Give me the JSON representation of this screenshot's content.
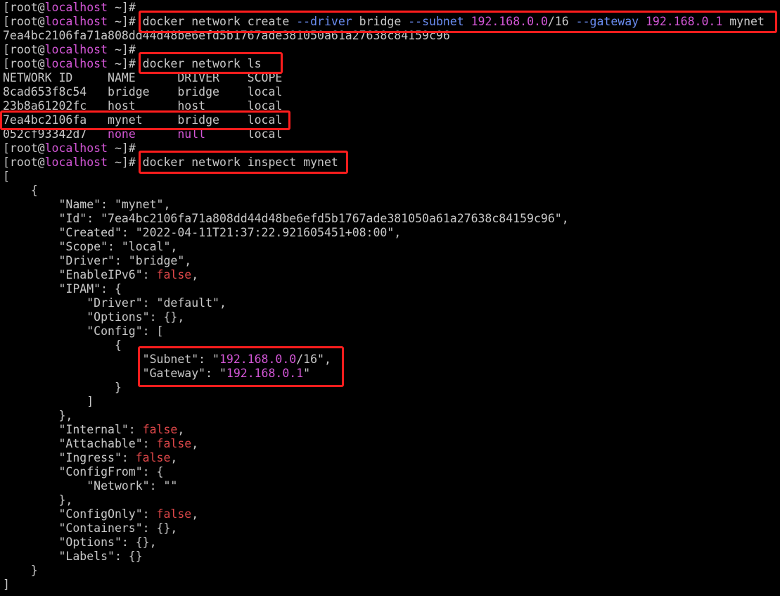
{
  "colors": {
    "background": "#000000",
    "text": "#c8c8c8",
    "host": "#d356d6",
    "flag": "#6a8cf0",
    "ip": "#d356d6",
    "boolean_false": "#e0484a",
    "highlight": "#ff1d1d"
  },
  "terminal": {
    "lines": [
      [
        {
          "t": "[root@",
          "c": "default"
        },
        {
          "t": "localhost",
          "c": "host"
        },
        {
          "t": " ~]#",
          "c": "default"
        }
      ],
      [
        {
          "t": "[root@",
          "c": "default"
        },
        {
          "t": "localhost",
          "c": "host"
        },
        {
          "t": " ~]# docker network create ",
          "c": "default"
        },
        {
          "t": "--driver",
          "c": "flag"
        },
        {
          "t": " bridge ",
          "c": "default"
        },
        {
          "t": "--subnet",
          "c": "flag"
        },
        {
          "t": " ",
          "c": "default"
        },
        {
          "t": "192.168.0.0",
          "c": "ip"
        },
        {
          "t": "/16 ",
          "c": "default"
        },
        {
          "t": "--gateway",
          "c": "flag"
        },
        {
          "t": " ",
          "c": "default"
        },
        {
          "t": "192.168.0.1",
          "c": "ip"
        },
        {
          "t": " mynet",
          "c": "default"
        }
      ],
      [
        {
          "t": "7ea4bc2106fa71a808dd44d48be6efd5b1767ade381050a61a27638c84159c96",
          "c": "default"
        }
      ],
      [
        {
          "t": "[root@",
          "c": "default"
        },
        {
          "t": "localhost",
          "c": "host"
        },
        {
          "t": " ~]#",
          "c": "default"
        }
      ],
      [
        {
          "t": "[root@",
          "c": "default"
        },
        {
          "t": "localhost",
          "c": "host"
        },
        {
          "t": " ~]# docker network ls",
          "c": "default"
        }
      ],
      [
        {
          "t": "NETWORK ID     NAME      DRIVER    SCOPE",
          "c": "default"
        }
      ],
      [
        {
          "t": "8cad653f8c54   bridge    bridge    local",
          "c": "default"
        }
      ],
      [
        {
          "t": "23b8a61202fc   host      host      local",
          "c": "default"
        }
      ],
      [
        {
          "t": "7ea4bc2106fa   mynet     bridge    local",
          "c": "default"
        }
      ],
      [
        {
          "t": "052cf93342d7   ",
          "c": "default"
        },
        {
          "t": "none",
          "c": "magenta"
        },
        {
          "t": "      ",
          "c": "default"
        },
        {
          "t": "null",
          "c": "magenta"
        },
        {
          "t": "      local",
          "c": "default"
        }
      ],
      [
        {
          "t": "[root@",
          "c": "default"
        },
        {
          "t": "localhost",
          "c": "host"
        },
        {
          "t": " ~]#",
          "c": "default"
        }
      ],
      [
        {
          "t": "[root@",
          "c": "default"
        },
        {
          "t": "localhost",
          "c": "host"
        },
        {
          "t": " ~]# docker network inspect mynet",
          "c": "default"
        }
      ],
      [
        {
          "t": "[",
          "c": "default"
        }
      ],
      [
        {
          "t": "    {",
          "c": "default"
        }
      ],
      [
        {
          "t": "        \"Name\": \"mynet\",",
          "c": "default"
        }
      ],
      [
        {
          "t": "        \"Id\": \"7ea4bc2106fa71a808dd44d48be6efd5b1767ade381050a61a27638c84159c96\",",
          "c": "default"
        }
      ],
      [
        {
          "t": "        \"Created\": \"2022-04-11T21:37:22.921605451+08:00\",",
          "c": "default"
        }
      ],
      [
        {
          "t": "        \"Scope\": \"local\",",
          "c": "default"
        }
      ],
      [
        {
          "t": "        \"Driver\": \"bridge\",",
          "c": "default"
        }
      ],
      [
        {
          "t": "        \"EnableIPv6\": ",
          "c": "default"
        },
        {
          "t": "false",
          "c": "false"
        },
        {
          "t": ",",
          "c": "default"
        }
      ],
      [
        {
          "t": "        \"IPAM\": {",
          "c": "default"
        }
      ],
      [
        {
          "t": "            \"Driver\": \"default\",",
          "c": "default"
        }
      ],
      [
        {
          "t": "            \"Options\": {},",
          "c": "default"
        }
      ],
      [
        {
          "t": "            \"Config\": [",
          "c": "default"
        }
      ],
      [
        {
          "t": "                {",
          "c": "default"
        }
      ],
      [
        {
          "t": "                    \"Subnet\": \"",
          "c": "default"
        },
        {
          "t": "192.168.0.0",
          "c": "ip"
        },
        {
          "t": "/16\",",
          "c": "default"
        }
      ],
      [
        {
          "t": "                    \"Gateway\": \"",
          "c": "default"
        },
        {
          "t": "192.168.0.1",
          "c": "ip"
        },
        {
          "t": "\"",
          "c": "default"
        }
      ],
      [
        {
          "t": "                }",
          "c": "default"
        }
      ],
      [
        {
          "t": "            ]",
          "c": "default"
        }
      ],
      [
        {
          "t": "        },",
          "c": "default"
        }
      ],
      [
        {
          "t": "        \"Internal\": ",
          "c": "default"
        },
        {
          "t": "false",
          "c": "false"
        },
        {
          "t": ",",
          "c": "default"
        }
      ],
      [
        {
          "t": "        \"Attachable\": ",
          "c": "default"
        },
        {
          "t": "false",
          "c": "false"
        },
        {
          "t": ",",
          "c": "default"
        }
      ],
      [
        {
          "t": "        \"Ingress\": ",
          "c": "default"
        },
        {
          "t": "false",
          "c": "false"
        },
        {
          "t": ",",
          "c": "default"
        }
      ],
      [
        {
          "t": "        \"ConfigFrom\": {",
          "c": "default"
        }
      ],
      [
        {
          "t": "            \"Network\": \"\"",
          "c": "default"
        }
      ],
      [
        {
          "t": "        },",
          "c": "default"
        }
      ],
      [
        {
          "t": "        \"ConfigOnly\": ",
          "c": "default"
        },
        {
          "t": "false",
          "c": "false"
        },
        {
          "t": ",",
          "c": "default"
        }
      ],
      [
        {
          "t": "        \"Containers\": {},",
          "c": "default"
        }
      ],
      [
        {
          "t": "        \"Options\": {},",
          "c": "default"
        }
      ],
      [
        {
          "t": "        \"Labels\": {}",
          "c": "default"
        }
      ],
      [
        {
          "t": "    }",
          "c": "default"
        }
      ],
      [
        {
          "t": "]",
          "c": "default"
        }
      ]
    ]
  }
}
